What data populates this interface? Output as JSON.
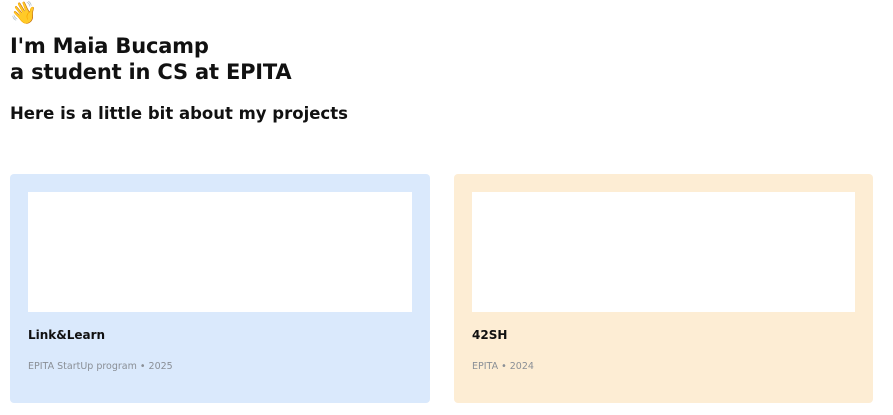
{
  "header": {
    "wave_emoji": "👋",
    "title_line1": "I'm Maia Bucamp",
    "title_line2": "a student in CS at EPITA",
    "subtitle": "Here is a little bit about my projects"
  },
  "projects": [
    {
      "title": "Link&Learn",
      "meta": "EPITA StartUp program • 2025",
      "color": "#dae9fc"
    },
    {
      "title": "42SH",
      "meta": "EPITA • 2024",
      "color": "#fdedd4"
    }
  ]
}
